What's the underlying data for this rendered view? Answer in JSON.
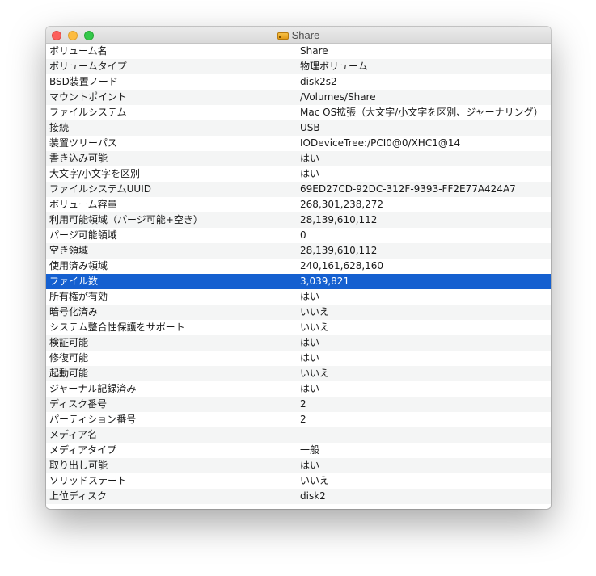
{
  "window": {
    "title": "Share",
    "title_icon": "external-disk-icon",
    "controls": [
      "close",
      "minimize",
      "zoom"
    ]
  },
  "colors": {
    "selection": "#1560d0",
    "stripe": "#f4f5f5",
    "close": "#fc605c",
    "minimize": "#fdbc40",
    "zoom": "#34c84a"
  },
  "selected_row": 15,
  "rows": [
    {
      "key": "ボリューム名",
      "value": "Share"
    },
    {
      "key": "ボリュームタイプ",
      "value": "物理ボリューム"
    },
    {
      "key": "BSD装置ノード",
      "value": "disk2s2"
    },
    {
      "key": "マウントポイント",
      "value": "/Volumes/Share"
    },
    {
      "key": "ファイルシステム",
      "value": "Mac OS拡張（大文字/小文字を区別、ジャーナリング）"
    },
    {
      "key": "接続",
      "value": "USB"
    },
    {
      "key": "装置ツリーパス",
      "value": "IODeviceTree:/PCI0@0/XHC1@14"
    },
    {
      "key": "書き込み可能",
      "value": "はい"
    },
    {
      "key": "大文字/小文字を区別",
      "value": "はい"
    },
    {
      "key": "ファイルシステムUUID",
      "value": "69ED27CD-92DC-312F-9393-FF2E77A424A7"
    },
    {
      "key": "ボリューム容量",
      "value": "268,301,238,272"
    },
    {
      "key": "利用可能領域（パージ可能+空き）",
      "value": "28,139,610,112"
    },
    {
      "key": "パージ可能領域",
      "value": "0"
    },
    {
      "key": "空き領域",
      "value": "28,139,610,112"
    },
    {
      "key": "使用済み領域",
      "value": "240,161,628,160"
    },
    {
      "key": "ファイル数",
      "value": "3,039,821"
    },
    {
      "key": "所有権が有効",
      "value": "はい"
    },
    {
      "key": "暗号化済み",
      "value": "いいえ"
    },
    {
      "key": "システム整合性保護をサポート",
      "value": "いいえ"
    },
    {
      "key": "検証可能",
      "value": "はい"
    },
    {
      "key": "修復可能",
      "value": "はい"
    },
    {
      "key": "起動可能",
      "value": "いいえ"
    },
    {
      "key": "ジャーナル記録済み",
      "value": "はい"
    },
    {
      "key": "ディスク番号",
      "value": "2"
    },
    {
      "key": "パーティション番号",
      "value": "2"
    },
    {
      "key": "メディア名",
      "value": ""
    },
    {
      "key": "メディアタイプ",
      "value": "一般"
    },
    {
      "key": "取り出し可能",
      "value": "はい"
    },
    {
      "key": "ソリッドステート",
      "value": "いいえ"
    },
    {
      "key": "上位ディスク",
      "value": "disk2"
    }
  ]
}
